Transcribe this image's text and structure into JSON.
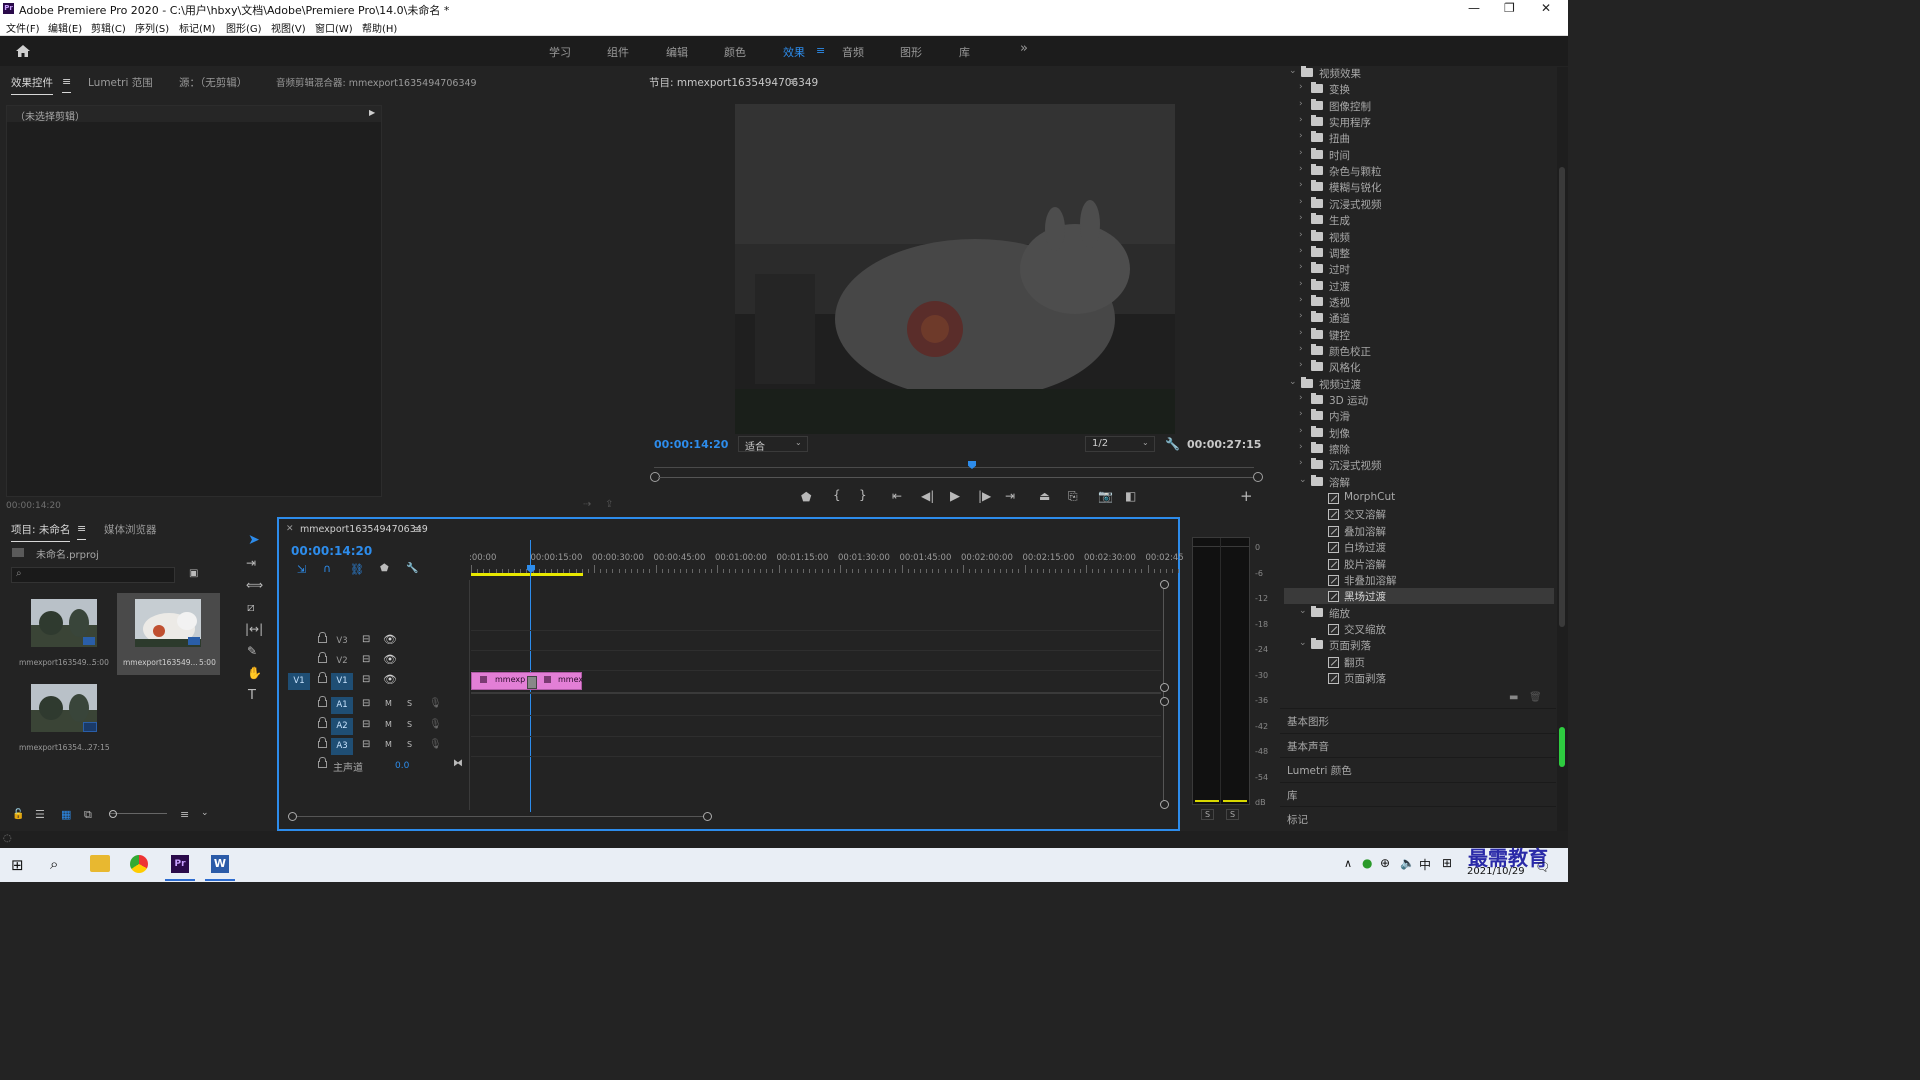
{
  "window": {
    "title": "Adobe Premiere Pro 2020 - C:\\用户\\hbxy\\文档\\Adobe\\Premiere Pro\\14.0\\未命名 *",
    "app_badge": "Pr"
  },
  "menu": [
    "文件(F)",
    "编辑(E)",
    "剪辑(C)",
    "序列(S)",
    "标记(M)",
    "图形(G)",
    "视图(V)",
    "窗口(W)",
    "帮助(H)"
  ],
  "workspaces": {
    "items": [
      "学习",
      "组件",
      "编辑",
      "颜色",
      "效果",
      "音频",
      "图形",
      "库"
    ],
    "active": "效果",
    "more": "»"
  },
  "source_panel": {
    "tabs": [
      "效果控件",
      "Lumetri 范围",
      "源：（无剪辑）",
      "音频剪辑混合器: mmexport1635494706349"
    ],
    "no_clip": "（未选择剪辑）",
    "timecode": "00:00:14:20"
  },
  "program_monitor": {
    "title": "节目: mmexport1635494706349",
    "timecode": "00:00:14:20",
    "fit": "适合",
    "resolution": "1/2",
    "duration": "00:00:27:15",
    "playhead_fraction": 0.53
  },
  "project_panel": {
    "tabs": [
      "项目: 未命名",
      "媒体浏览器"
    ],
    "project_file": "未命名.prproj",
    "items": [
      {
        "name": "mmexport163549...",
        "duration": "5:00"
      },
      {
        "name": "mmexport163549...",
        "duration": "5:00"
      },
      {
        "name": "mmexport16354...",
        "duration": "27:15"
      }
    ]
  },
  "timeline": {
    "sequence": "mmexport1635494706349",
    "timecode": "00:00:14:20",
    "ruler": [
      ":00:00",
      "00:00:15:00",
      "00:00:30:00",
      "00:00:45:00",
      "00:01:00:00",
      "00:01:15:00",
      "00:01:30:00",
      "00:01:45:00",
      "00:02:00:00",
      "00:02:15:00",
      "00:02:30:00",
      "00:02:45:"
    ],
    "video_tracks": [
      "V3",
      "V2",
      "V1"
    ],
    "source_patch": "V1",
    "audio_tracks": [
      "A1",
      "A2",
      "A3"
    ],
    "mute": "M",
    "solo": "S",
    "master": {
      "label": "主声道",
      "value": "0.0"
    },
    "clips": [
      "mmexp",
      "mmex"
    ]
  },
  "audio_meter": {
    "scale": [
      "0",
      "-6",
      "-12",
      "-18",
      "-24",
      "-30",
      "-36",
      "-42",
      "-48",
      "-54",
      "dB"
    ],
    "solo_buttons": [
      "S",
      "S"
    ]
  },
  "effects": {
    "video_effects_label": "视频效果",
    "video_effects": [
      "变换",
      "图像控制",
      "实用程序",
      "扭曲",
      "时间",
      "杂色与颗粒",
      "模糊与锐化",
      "沉浸式视频",
      "生成",
      "视频",
      "调整",
      "过时",
      "过渡",
      "透视",
      "通道",
      "键控",
      "颜色校正",
      "风格化"
    ],
    "video_transitions_label": "视频过渡",
    "video_transitions": [
      "3D 运动",
      "内滑",
      "划像",
      "擦除",
      "沉浸式视频"
    ],
    "dissolve_label": "溶解",
    "dissolve": [
      "MorphCut",
      "交叉溶解",
      "叠加溶解",
      "白场过渡",
      "胶片溶解",
      "非叠加溶解",
      "黑场过渡"
    ],
    "selected": "黑场过渡",
    "zoom_label": "缩放",
    "zoom": [
      "交叉缩放"
    ],
    "page_peel_label": "页面剥落",
    "page_peel": [
      "翻页",
      "页面剥落"
    ]
  },
  "side_panels": [
    "基本图形",
    "基本声音",
    "Lumetri 颜色",
    "库",
    "标记"
  ],
  "taskbar": {
    "ime": "中",
    "date": "2021/10/29",
    "watermark": "最需教育"
  }
}
